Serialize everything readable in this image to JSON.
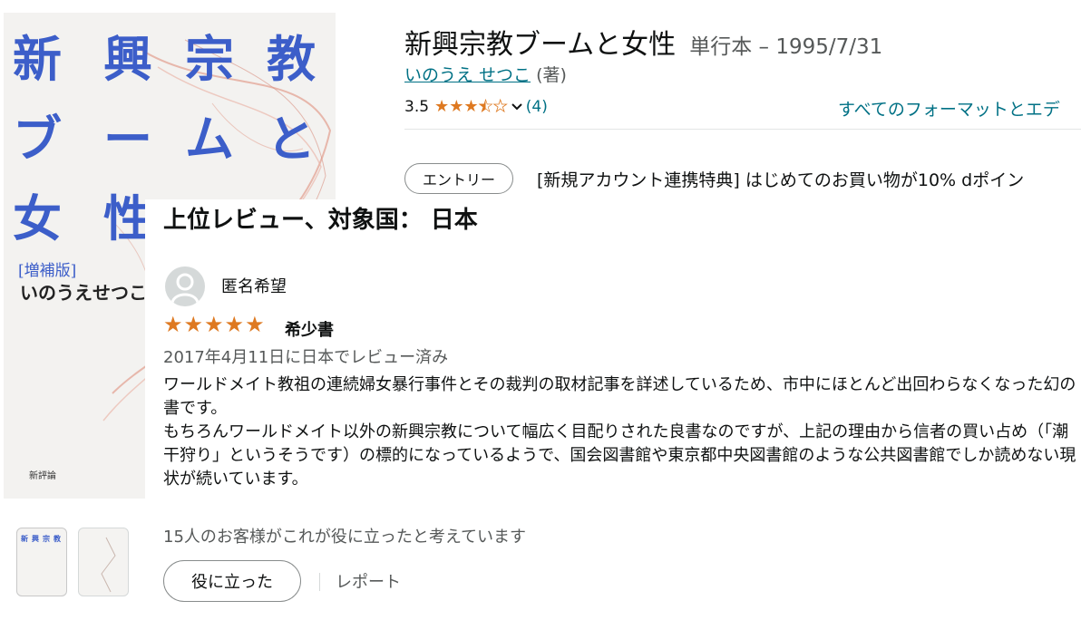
{
  "cover": {
    "title_chars": [
      "新",
      "興",
      "宗",
      "教",
      "ブ",
      "ー",
      "ム",
      "と",
      "女",
      "性"
    ],
    "edition": "[増補版]",
    "author": "いのうえせつこ",
    "publisher": "新評論"
  },
  "product": {
    "title": "新興宗教ブームと女性",
    "binding": "単行本 – 1995/7/31",
    "author_link": "いのうえ せつこ",
    "author_role": "(著)",
    "rating_value": "3.5",
    "rating_fraction": 0.7,
    "rating_count": "(4)",
    "formats_link": "すべてのフォーマットとエデ"
  },
  "promo": {
    "entry_label": "エントリー",
    "text": "[新規アカウント連携特典] はじめてのお買い物が10% dポイン"
  },
  "review": {
    "heading": "上位レビュー、対象国： 日本",
    "reviewer": "匿名希望",
    "stars": 5,
    "title": "希少書",
    "date": "2017年4月11日に日本でレビュー済み",
    "body_p1": "ワールドメイト教祖の連続婦女暴行事件とその裁判の取材記事を詳述しているため、市中にほとんど出回わらなくなった幻の書です。",
    "body_p2": "もちろんワールドメイト以外の新興宗教について幅広く目配りされた良書なのですが、上記の理由から信者の買い占め（「潮干狩り」というそうです）の標的になっているようで、国会図書館や東京都中央図書館のような公共図書館でしか読めない現状が続いています。",
    "helpful_count": "15人のお客様がこれが役に立ったと考えています",
    "helpful_button": "役に立った",
    "report": "レポート"
  },
  "colors": {
    "link": "#007185",
    "star": "#de7921",
    "cover_title": "#3c5ec9"
  }
}
